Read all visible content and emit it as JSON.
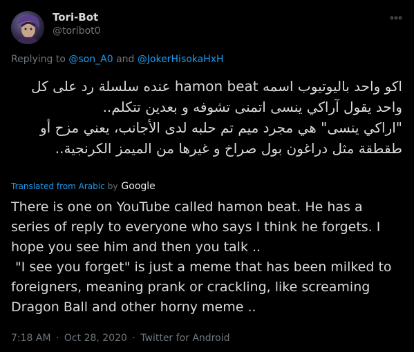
{
  "author": {
    "display_name": "Tori-Bot",
    "handle": "@toribot0"
  },
  "reply": {
    "prefix": "Replying to",
    "mention_1": "@son_A0",
    "conjunction": "and",
    "mention_2": "@JokerHisokaHxH"
  },
  "tweet": {
    "original_text": "اكو واحد باليوتيوب اسمه hamon beat عنده سلسلة رد على كل واحد يقول آراكي ينسى اتمنى تشوفه و بعدين تتكلم..\n\"اراكي ينسى\" هي مجرد ميم تم حلبه لدى الأجانب، يعني مزح أو طقطقة مثل دراغون بول صراخ و غيرها من الميمز الكرنجية..",
    "translated_label": "Translated from Arabic",
    "by_label": "by",
    "translator": "Google",
    "translated_text": "There is one on YouTube called hamon beat. He has a series of reply to everyone who says I think he forgets. I hope you see him and then you talk ..\n \"I see you forget\" is just a meme that has been milked to foreigners, meaning prank or crackling, like screaming Dragon Ball and other horny meme .."
  },
  "meta": {
    "time": "7:18 AM",
    "date": "Oct 28, 2020",
    "separator": "·",
    "source": "Twitter for Android"
  },
  "icons": {
    "more": "more-options-icon"
  },
  "colors": {
    "background": "#000000",
    "text": "#d9d9d9",
    "muted": "#6e767d",
    "link": "#1d9bf0"
  }
}
